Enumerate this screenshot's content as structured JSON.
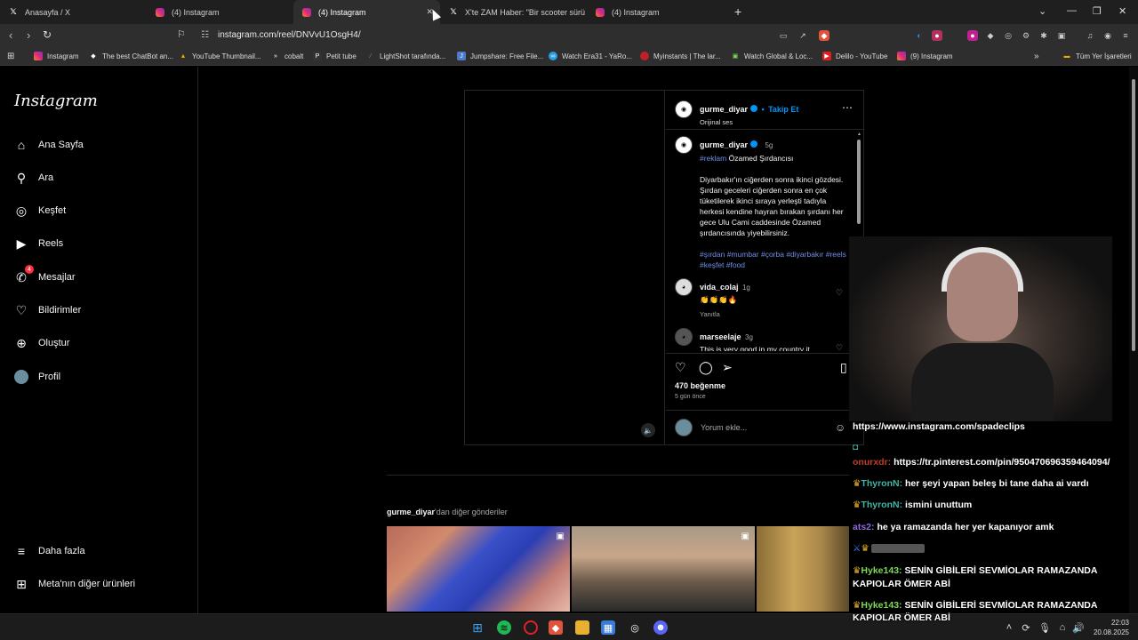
{
  "browser": {
    "tabs": [
      {
        "label": "Anasayfa / X",
        "icon": "x-icon"
      },
      {
        "label": "(4) Instagram",
        "icon": "instagram-icon"
      },
      {
        "label": "(4) Instagram",
        "icon": "instagram-icon",
        "active": true
      },
      {
        "label": "X'te ZAM Haber: \"Bir scooter sürücüs",
        "icon": "x-icon"
      },
      {
        "label": "(4) Instagram",
        "icon": "instagram-icon"
      }
    ],
    "url": "instagram.com/reel/DNVvU1OsgH4/",
    "bookmarks": [
      "Instagram",
      "The best ChatBot an...",
      "YouTube Thumbnail...",
      "cobalt",
      "Petit tube",
      "LightShot tarafında...",
      "Jumpshare: Free File...",
      "Watch Era31 - YaRo...",
      "Myinstants | The lar...",
      "Watch Global & Loc...",
      "Delilo - YouTube",
      "(9) Instagram"
    ],
    "all_bookmarks": "Tüm Yer İşaretleri"
  },
  "sidebar": {
    "logo": "Instagram",
    "items": [
      {
        "label": "Ana Sayfa",
        "icon": "home-icon"
      },
      {
        "label": "Ara",
        "icon": "search-icon"
      },
      {
        "label": "Keşfet",
        "icon": "compass-icon"
      },
      {
        "label": "Reels",
        "icon": "reels-icon"
      },
      {
        "label": "Mesajlar",
        "icon": "messenger-icon",
        "badge": "4"
      },
      {
        "label": "Bildirimler",
        "icon": "heart-icon"
      },
      {
        "label": "Oluştur",
        "icon": "plus-icon"
      },
      {
        "label": "Profil",
        "icon": "avatar"
      }
    ],
    "more": "Daha fazla",
    "meta": "Meta'nın diğer ürünleri"
  },
  "post": {
    "author": "gurme_diyar",
    "follow": "Takip Et",
    "dot": "•",
    "audio": "Orijinal ses",
    "caption_time": "5g",
    "caption_tag": "#reklam",
    "caption_title": "Özamed Şırdancısı",
    "caption_body": "Diyarbakır'ın ciğerden sonra ikinci gözdesi. Şırdan geceleri ciğerden sonra en çok tüketilerek ikinci sıraya yerleşti tadıyla herkesi kendine hayran bırakan şırdanı her gece Ulu Cami caddesinde Özamed şırdancısında yiyebilirsiniz.",
    "hashtags": "#şırdan #mumbar #çorba #diyarbakır #reels #keşfet #food",
    "comments": [
      {
        "user": "vida_colaj",
        "time": "1g",
        "text": "👏👏👏🔥",
        "reply": "Yanıtla"
      },
      {
        "user": "marseelaje",
        "time": "3g",
        "text": "This is very good in my country it",
        "reply": ""
      }
    ],
    "likes": "470 beğenme",
    "posted": "5 gün önce",
    "comment_placeholder": "Yorum ekle..."
  },
  "more_posts": {
    "author": "gurme_diyar",
    "suffix": "'dan diğer gönderiler"
  },
  "chat": [
    {
      "name": "",
      "msg": "https://www.instagram.com/spadeclips",
      "color": "#ffffff"
    },
    {
      "name": "onurxdr:",
      "msg": "https://tr.pinterest.com/pin/950470696359464094/",
      "color": "#c0392b"
    },
    {
      "name": "ThyronN:",
      "msg": "her şeyi yapan beleş bi tane daha ai vardı",
      "color": "#3fb5a6"
    },
    {
      "name": "ThyronN:",
      "msg": "ismini unuttum",
      "color": "#3fb5a6"
    },
    {
      "name": "ats2:",
      "msg": "he ya ramazanda her yer kapanıyor amk",
      "color": "#8e6bd8"
    },
    {
      "name": "Hyke143:",
      "msg": "SENİN GİBİLERİ SEVMİOLAR RAMAZANDA",
      "color": "#7ed957"
    },
    {
      "name": "",
      "msg": "KAPIOLAR ÖMER ABİ",
      "color": "#ffffff"
    },
    {
      "name": "Hyke143:",
      "msg": "SENİN GİBİLERİ SEVMİOLAR RAMAZANDA",
      "color": "#7ed957"
    },
    {
      "name": "",
      "msg": "KAPIOLAR ÖMER ABİ",
      "color": "#ffffff"
    }
  ],
  "clock": {
    "time": "22:03",
    "date": "20.08.2025"
  },
  "colors": {
    "accent": "#0095f6",
    "badge": "#ff3040",
    "hashtag": "#6e8fe8"
  }
}
